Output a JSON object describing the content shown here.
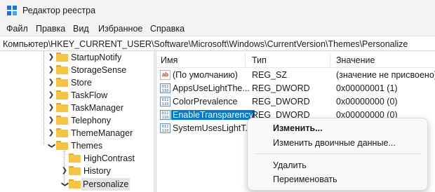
{
  "window": {
    "title": "Редактор реестра"
  },
  "menu": [
    "Файл",
    "Правка",
    "Вид",
    "Избранное",
    "Справка"
  ],
  "address": "Компьютер\\HKEY_CURRENT_USER\\Software\\Microsoft\\Windows\\CurrentVersion\\Themes\\Personalize",
  "tree": {
    "items": [
      {
        "label": "StartupNotify"
      },
      {
        "label": "StorageSense"
      },
      {
        "label": "Store"
      },
      {
        "label": "TaskFlow"
      },
      {
        "label": "TaskManager"
      },
      {
        "label": "Telephony"
      },
      {
        "label": "ThemeManager"
      },
      {
        "label": "Themes",
        "expanded": true
      },
      {
        "label": "HighContrast"
      },
      {
        "label": "History"
      },
      {
        "label": "Personalize",
        "selected": true
      }
    ]
  },
  "list": {
    "columns": [
      "Имя",
      "Тип",
      "Значение"
    ],
    "rows": [
      {
        "name": "(По умолчанию)",
        "type": "REG_SZ",
        "value": "(значение не присвоено)",
        "icon": "string-value-icon"
      },
      {
        "name": "AppsUseLightThe...",
        "type": "REG_DWORD",
        "value": "0x00000001 (1)",
        "icon": "binary-value-icon"
      },
      {
        "name": "ColorPrevalence",
        "type": "REG_DWORD",
        "value": "0x00000000 (0)",
        "icon": "binary-value-icon"
      },
      {
        "name": "EnableTransparency",
        "type": "REG_DWORD",
        "value": "0x00000000 (0)",
        "icon": "binary-value-icon",
        "selected": true
      },
      {
        "name": "SystemUsesLightT...",
        "type": "",
        "value": "",
        "icon": "binary-value-icon"
      }
    ]
  },
  "context_menu": {
    "modify": "Изменить...",
    "modify_binary": "Изменить двоичные данные...",
    "delete": "Удалить",
    "rename": "Переименовать"
  },
  "colors": {
    "selection": "#0078d4",
    "folder": "#f6c343"
  }
}
